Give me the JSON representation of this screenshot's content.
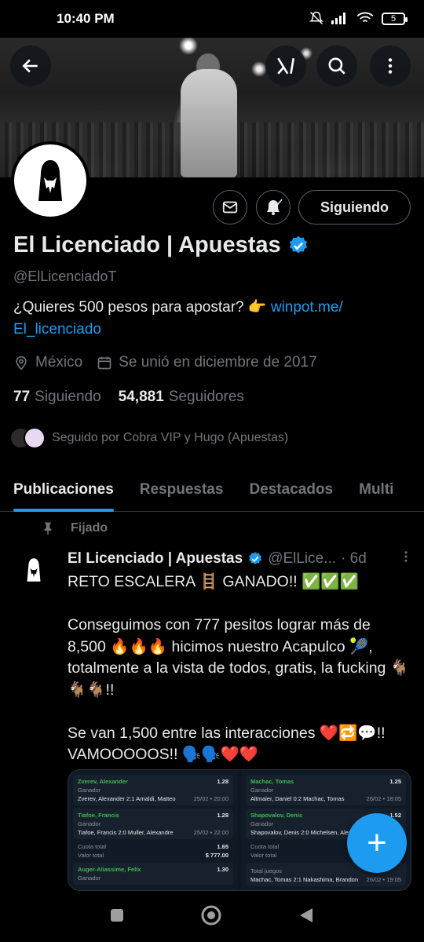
{
  "status_bar": {
    "time": "10:40 PM",
    "battery": "5",
    "signal_label": "4G"
  },
  "profile": {
    "display_name": "El Licenciado | Apuestas",
    "handle": "@ElLicenciadoT",
    "bio_text": "¿Quieres 500 pesos para apostar? 👉 ",
    "bio_link_1": "winpot.me/",
    "bio_link_2": "El_licenciado",
    "location": "México",
    "joined": "Se unió en diciembre de 2017",
    "following_count": "77",
    "following_label": "Siguiendo",
    "followers_count": "54,881",
    "followers_label": "Seguidores",
    "followed_by": "Seguido por Cobra VIP y Hugo (Apuestas)",
    "follow_button": "Siguiendo"
  },
  "tabs": [
    {
      "label": "Publicaciones",
      "active": true
    },
    {
      "label": "Respuestas"
    },
    {
      "label": "Destacados"
    },
    {
      "label": "Multi"
    }
  ],
  "post": {
    "pinned_label": "Fijado",
    "name": "El Licenciado | Apuestas",
    "handle": "@ElLice...",
    "time": "· 6d",
    "text": "RETO ESCALERA 🪜 GANADO!! ✅✅✅\n\nConseguimos con 777 pesitos lograr más de 8,500 🔥🔥🔥 hicimos nuestro Acapulco 🎾, totalmente a la vista de todos, gratis, la fucking 🐐🐐🐐!!\n\nSe van 1,500 entre las interacciones ❤️🔁💬!! VAMOOOOOS!! 🗣️🗣️❤️❤️"
  },
  "media": {
    "left": {
      "bets": [
        {
          "selection": "Zverev, Alexander",
          "odds": "1.28",
          "market": "Ganador",
          "result": "Zverev, Alexander 2:1 Arnaldi, Matteo",
          "date": "25/02 • 20:00"
        },
        {
          "selection": "Tiafoe, Francis",
          "odds": "1.28",
          "market": "Ganador",
          "result": "Tiafoe, Francis 2:0 Muller, Alexandre",
          "date": "25/02 • 22:00"
        }
      ],
      "total_odds_label": "Cuota total",
      "total_odds": "1.65",
      "total_value_label": "Valor total",
      "total_value": "$ 777.00",
      "extra": {
        "selection": "Auger-Aliassime, Felix",
        "odds": "1.30",
        "market": "Ganador"
      }
    },
    "right": {
      "bets": [
        {
          "selection": "Machac, Tomas",
          "odds": "1.25",
          "market": "Ganador",
          "result": "Altmaier, Daniel 0:2 Machac, Tomas",
          "date": "26/02 • 18:05"
        },
        {
          "selection": "Shapovalov, Denis",
          "odds": "1.52",
          "market": "Ganador",
          "result": "Shapovalov, Denis 2:0 Michelsen, Alex",
          "date": ""
        }
      ],
      "total_odds_label": "Cuota total",
      "total_value_label": "Valor total",
      "extra_label": "Total juegos",
      "extra_result": "Machac, Tomas 2:1 Nakashima, Brandon",
      "extra_date": "26/02 • 19:05"
    }
  },
  "fab_label": "+",
  "colors": {
    "accent": "#1d9bf0",
    "background": "#000000",
    "muted": "#71767b",
    "text": "#e7e9ea"
  }
}
